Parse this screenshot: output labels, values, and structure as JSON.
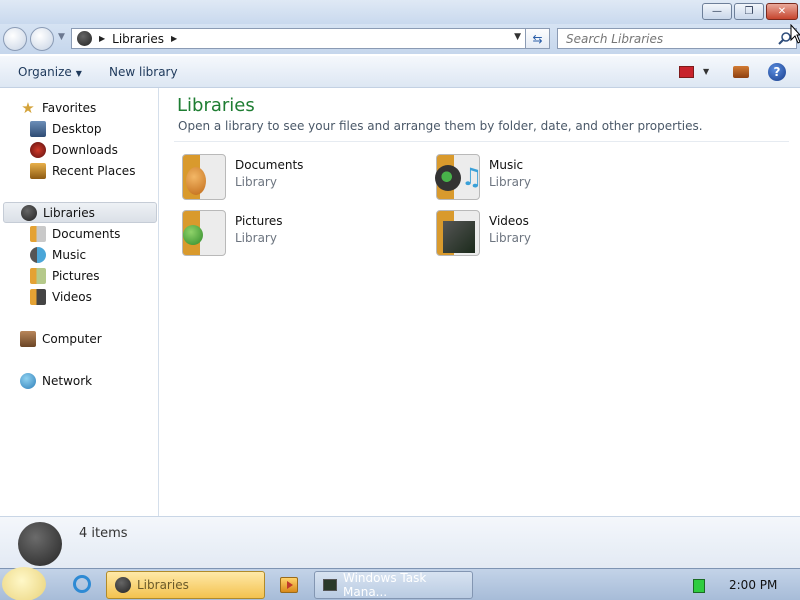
{
  "window": {
    "minimize_label": "—",
    "maximize_label": "❐",
    "close_label": "✕"
  },
  "address": {
    "location": "Libraries",
    "search_placeholder": "Search Libraries"
  },
  "toolbar": {
    "organize_label": "Organize",
    "new_library_label": "New library",
    "help_label": "?"
  },
  "sidebar": {
    "favorites": {
      "label": "Favorites",
      "items": [
        {
          "label": "Desktop"
        },
        {
          "label": "Downloads"
        },
        {
          "label": "Recent Places"
        }
      ]
    },
    "libraries": {
      "label": "Libraries",
      "selected": true,
      "items": [
        {
          "label": "Documents"
        },
        {
          "label": "Music"
        },
        {
          "label": "Pictures"
        },
        {
          "label": "Videos"
        }
      ]
    },
    "computer": {
      "label": "Computer"
    },
    "network": {
      "label": "Network"
    }
  },
  "main": {
    "title": "Libraries",
    "subtitle": "Open a library to see your files and arrange them by folder, date, and other properties.",
    "libraries": [
      {
        "name": "Documents",
        "type": "Library",
        "icon": "documents-library-icon"
      },
      {
        "name": "Music",
        "type": "Library",
        "icon": "music-library-icon"
      },
      {
        "name": "Pictures",
        "type": "Library",
        "icon": "pictures-library-icon"
      },
      {
        "name": "Videos",
        "type": "Library",
        "icon": "videos-library-icon"
      }
    ]
  },
  "details": {
    "item_count": "4 items"
  },
  "taskbar": {
    "tasks": [
      {
        "label": "Libraries",
        "active": true
      },
      {
        "label": "Windows Task Mana..."
      }
    ],
    "clock": "2:00 PM"
  },
  "colors": {
    "title_green": "#1e7d32",
    "nav_text": "#1e395b",
    "active_task": "#f3c24f"
  }
}
